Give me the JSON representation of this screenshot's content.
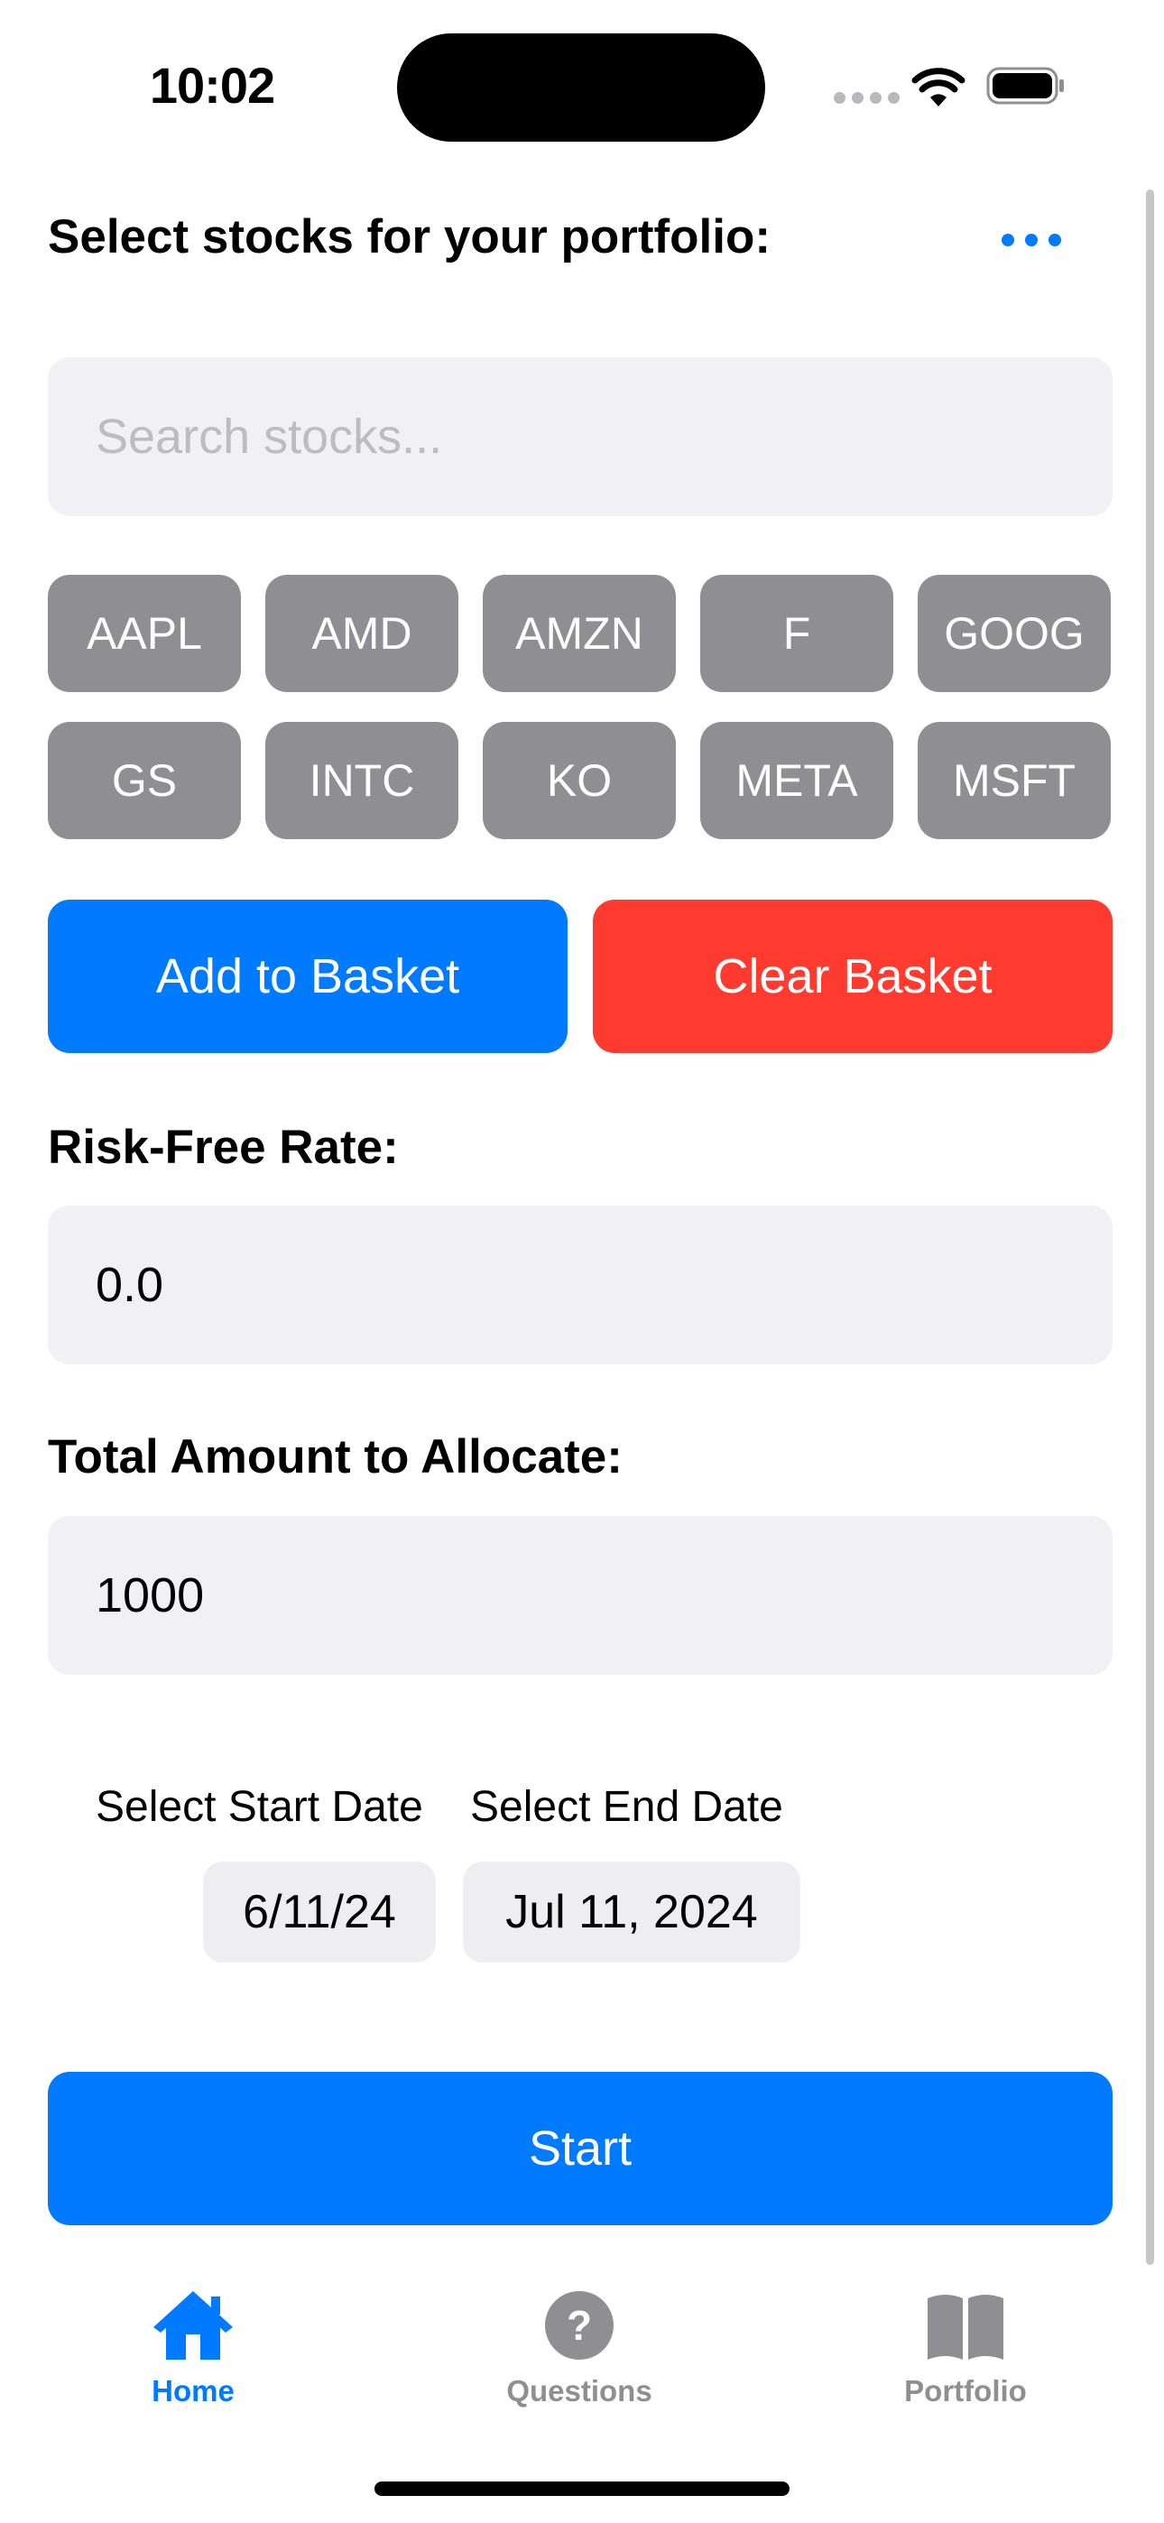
{
  "status_bar": {
    "time": "10:02"
  },
  "header": {
    "title": "Select stocks for your portfolio:",
    "more_icon": "ellipsis-icon"
  },
  "search": {
    "placeholder": "Search stocks...",
    "value": ""
  },
  "tickers": [
    "AAPL",
    "AMD",
    "AMZN",
    "F",
    "GOOG",
    "GS",
    "INTC",
    "KO",
    "META",
    "MSFT"
  ],
  "actions": {
    "add_label": "Add to Basket",
    "clear_label": "Clear Basket"
  },
  "risk_free": {
    "label": "Risk-Free Rate:",
    "value": "0.0"
  },
  "allocation": {
    "label": "Total Amount to Allocate:",
    "value": "1000"
  },
  "dates": {
    "start_label": "Select Start Date",
    "start_value": "6/11/24",
    "end_label": "Select End Date",
    "end_value": "Jul 11, 2024"
  },
  "start_button": {
    "label": "Start"
  },
  "tab_bar": {
    "tabs": [
      {
        "label": "Home",
        "icon": "house-icon",
        "active": true
      },
      {
        "label": "Questions",
        "icon": "question-circle-icon",
        "active": false
      },
      {
        "label": "Portfolio",
        "icon": "book-icon",
        "active": false
      }
    ]
  },
  "colors": {
    "accent": "#007aff",
    "destructive": "#ff3b30",
    "chip": "#8e8e93",
    "field_bg": "#f0f0f5",
    "inactive_tab": "#8e8e93"
  }
}
